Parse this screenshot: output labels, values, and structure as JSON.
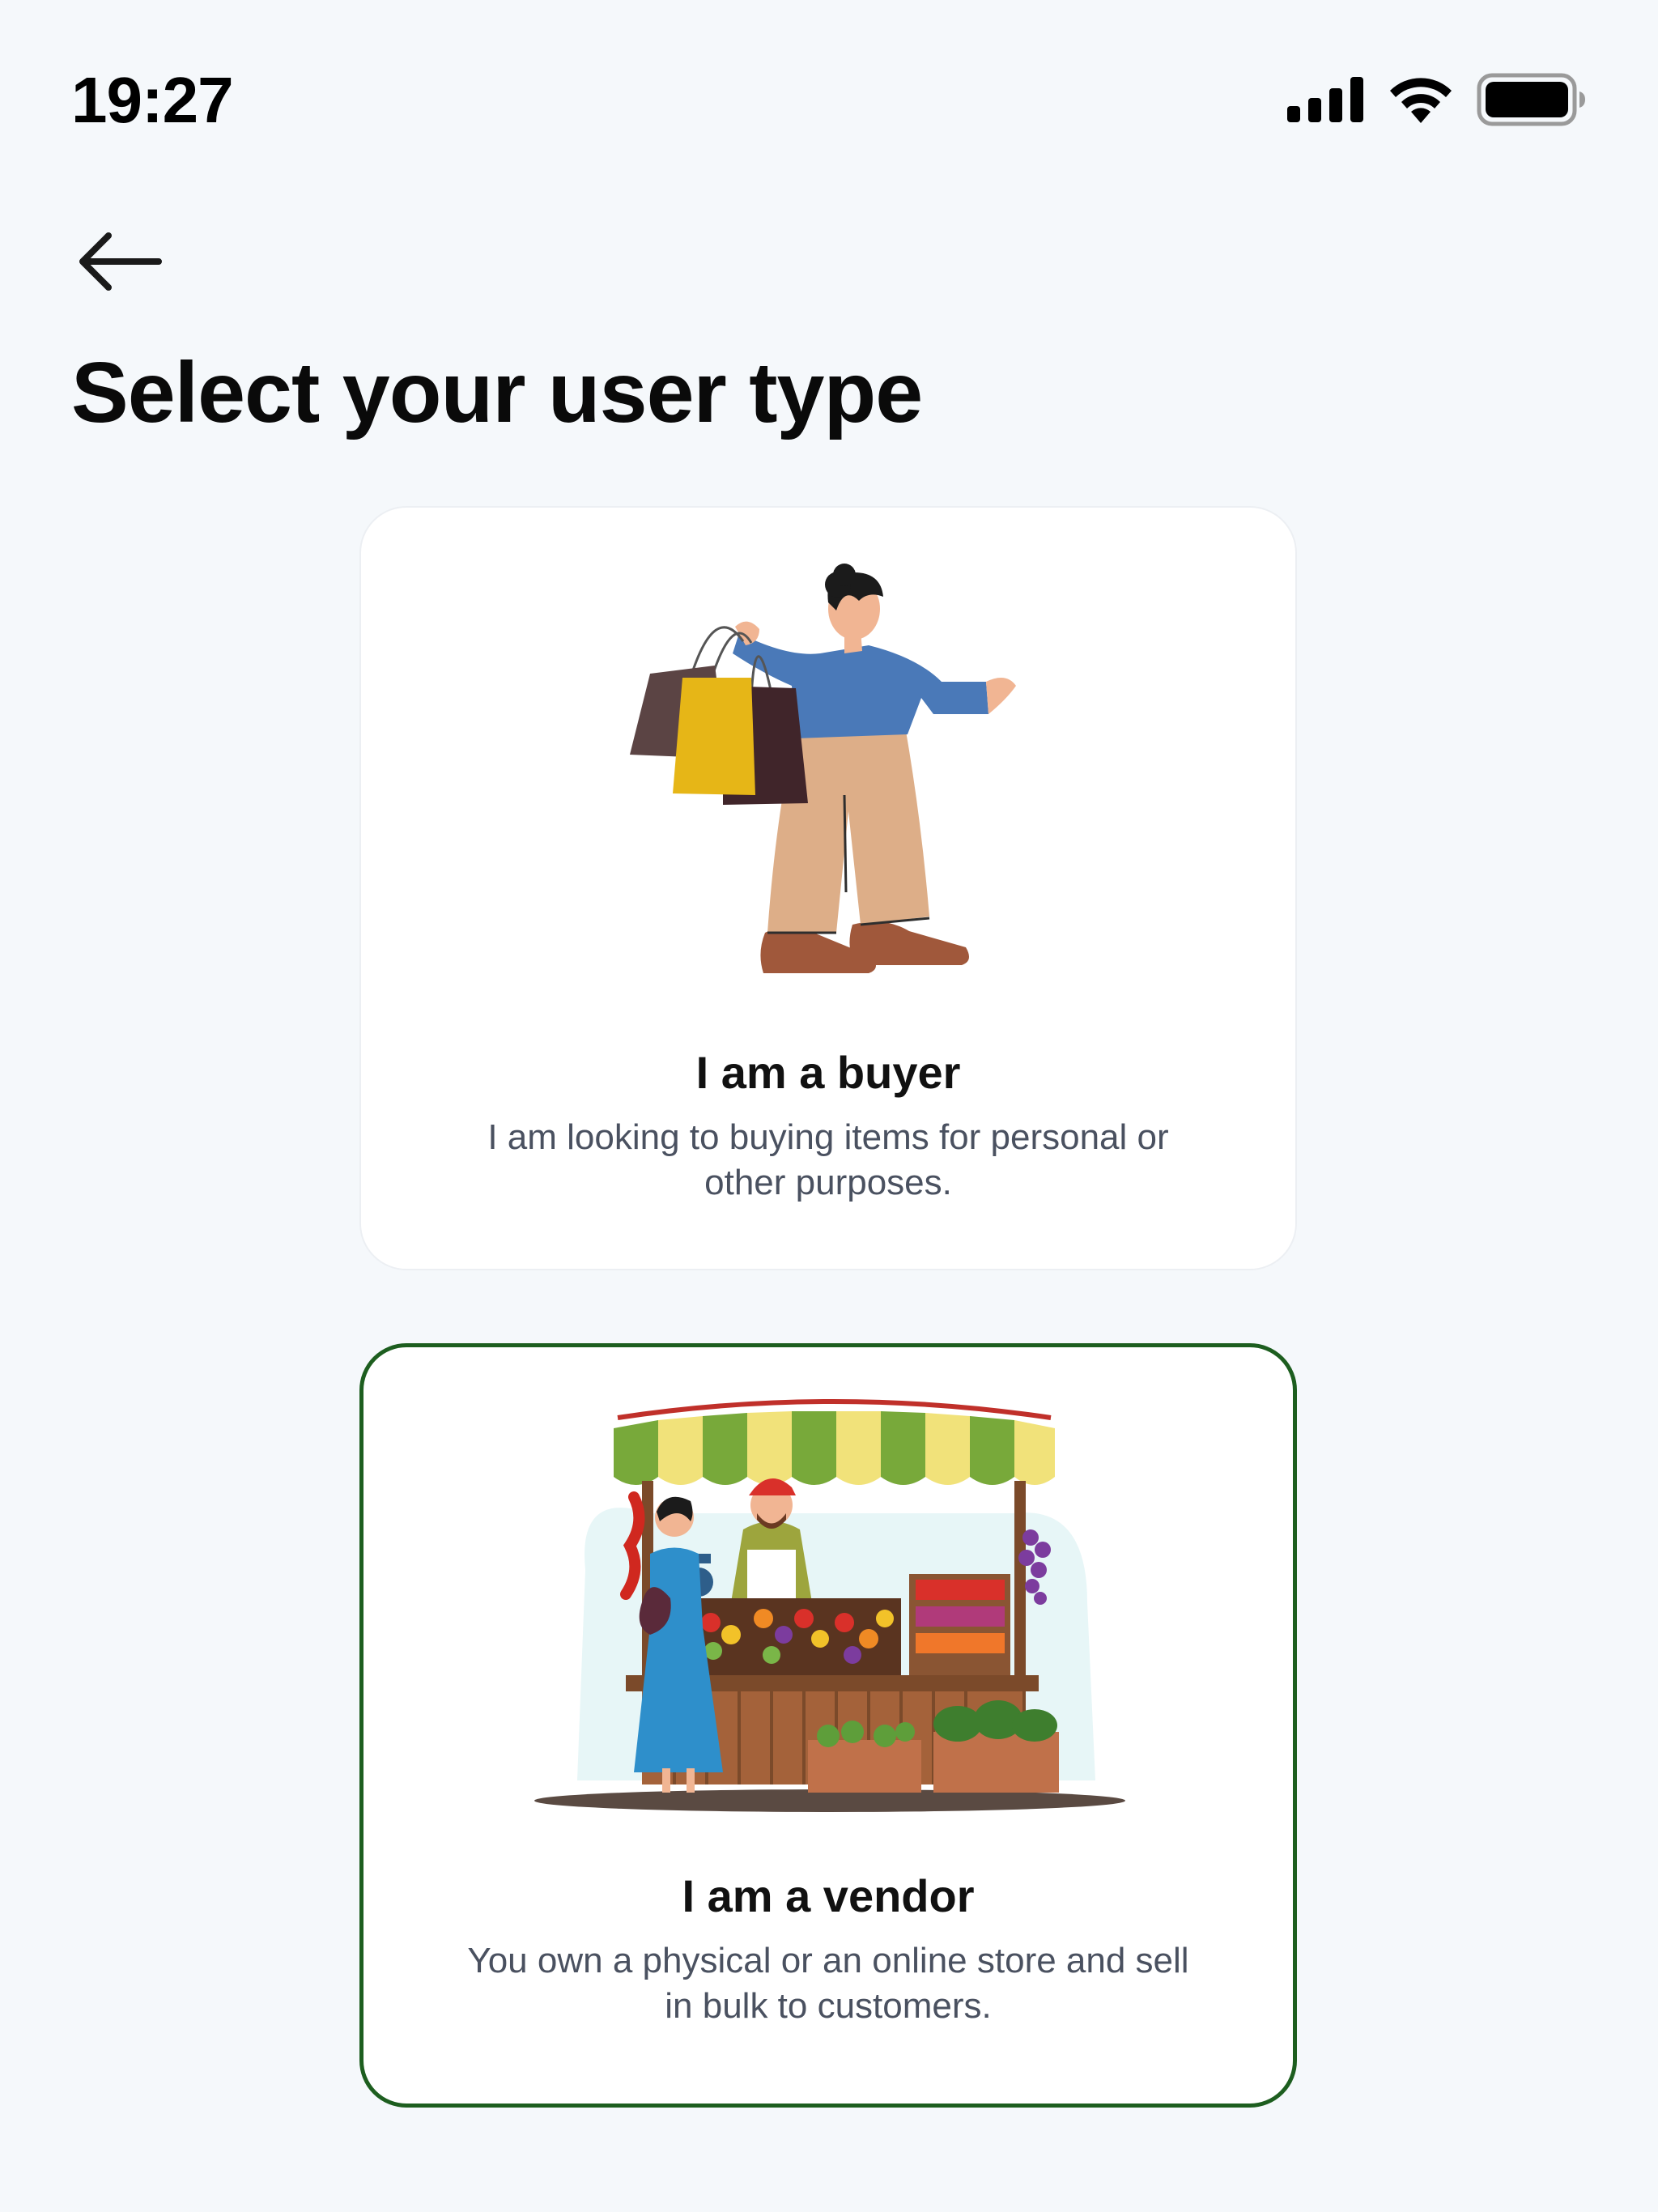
{
  "status_bar": {
    "time": "19:27",
    "icons": [
      "cellular-signal-icon",
      "wifi-icon",
      "battery-icon"
    ]
  },
  "header": {
    "back_icon": "arrow-left-icon",
    "title": "Select your user type"
  },
  "options": [
    {
      "id": "buyer",
      "title": "I am a buyer",
      "description": "I am looking to buying items for personal or other purposes.",
      "selected": false
    },
    {
      "id": "vendor",
      "title": "I am a vendor",
      "description": "You own a physical or an online store and sell in bulk to customers.",
      "selected": true
    }
  ],
  "colors": {
    "background": "#F5F8FB",
    "card": "#FFFFFF",
    "selected_border": "#1D5E1F",
    "title_text": "#0A0A0A",
    "description_text": "#4A5160"
  }
}
